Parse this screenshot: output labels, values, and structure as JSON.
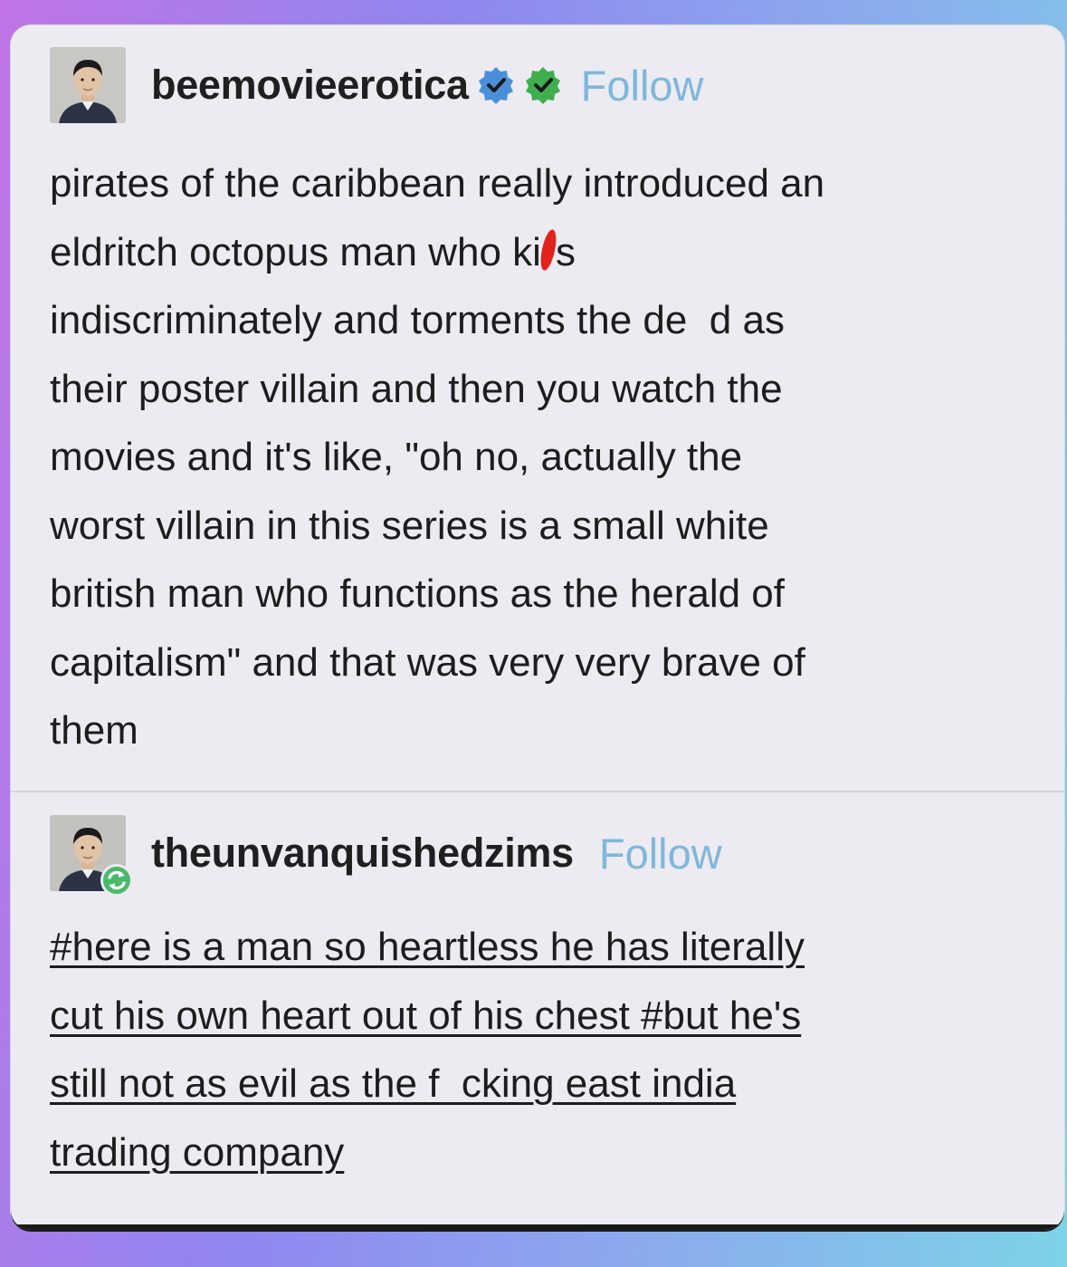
{
  "post_original": {
    "username": "beemovieerotica",
    "follow_label": "Follow",
    "badges": [
      "verified-blue-icon",
      "verified-green-icon"
    ],
    "body_lines": [
      "pirates of the caribbean really introduced an",
      "eldritch octopus man who ki",
      "s",
      "indiscriminately and torments the de  d as",
      "their poster villain and then you watch the",
      "movies and it's like, \"oh no, actually the",
      "worst villain in this series is a small white",
      "british man who functions as the herald of",
      "capitalism\" and that was very very brave of",
      "them"
    ]
  },
  "post_reblog": {
    "username": "theunvanquishedzims",
    "follow_label": "Follow",
    "tag_lines": [
      "#here is a man so heartless he has literally",
      "cut his own heart out of his chest #but he's",
      "still not as evil as the f  cking east india",
      "trading company"
    ]
  },
  "colors": {
    "follow": "#7fb7dc",
    "badge_blue": "#4a90d9",
    "badge_green": "#3fae4f",
    "redaction": "#e0231c",
    "card_bg": "#ecebf1"
  }
}
